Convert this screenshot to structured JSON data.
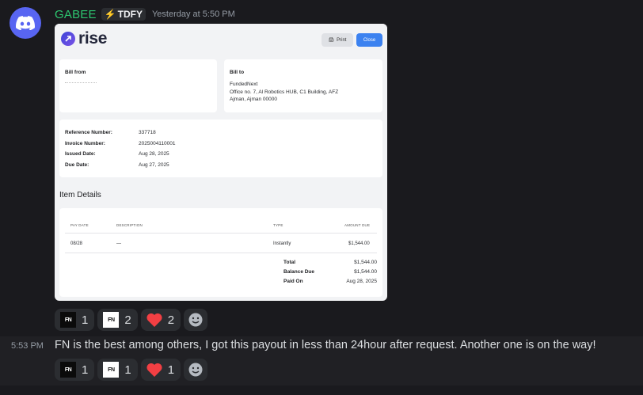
{
  "message1": {
    "username": "GABEE",
    "tag": "TDFY",
    "timestamp": "Yesterday at 5:50 PM",
    "invoice": {
      "brand": "rise",
      "print_label": "Print",
      "close_label": "Close",
      "bill_from_title": "Bill from",
      "bill_to_title": "Bill to",
      "bill_to_lines": [
        "FundedNext",
        "Office no. 7, Al Robotics HUB, C1 Building, AFZ",
        "Ajman, Ajman 00000"
      ],
      "reference_label": "Reference Number:",
      "reference_value": "337718",
      "invoice_label": "Invoice Number:",
      "invoice_value": "2025004110001",
      "issued_label": "Issued Date:",
      "issued_value": "Aug 28, 2025",
      "due_label": "Due Date:",
      "due_value": "Aug 27, 2025",
      "item_details_title": "Item Details",
      "columns": [
        "PAY DATE",
        "DESCRIPTION",
        "TYPE",
        "AMOUNT DUE"
      ],
      "row": {
        "pay_date": "08/28",
        "description": "—",
        "type": "Instantly",
        "amount": "$1,544.00"
      },
      "total_label": "Total",
      "total_value": "$1,544.00",
      "balance_label": "Balance Due",
      "balance_value": "$1,544.00",
      "paid_label": "Paid On",
      "paid_value": "Aug 28, 2025"
    },
    "reactions": [
      {
        "icon": "fn-black-emoji",
        "count": "1"
      },
      {
        "icon": "fn-white-emoji",
        "count": "2"
      },
      {
        "icon": "heart-emoji",
        "count": "2"
      }
    ]
  },
  "message2": {
    "timestamp": "5:53 PM",
    "text": "FN is the best among others, I got this payout in less than 24hour after request. Another one is on the way!",
    "reactions": [
      {
        "icon": "fn-black-emoji",
        "count": "1"
      },
      {
        "icon": "fn-white-emoji",
        "count": "1"
      },
      {
        "icon": "heart-emoji",
        "count": "1"
      }
    ]
  },
  "colors": {
    "background": "#1a1a1e",
    "username": "#2dc770",
    "avatar": "#5865f2",
    "heart": "#f23f43",
    "close_button": "#3c82f0"
  }
}
